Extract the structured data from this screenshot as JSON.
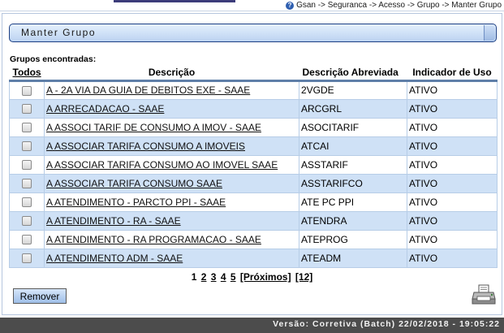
{
  "breadcrumb": "Gsan -> Seguranca -> Acesso -> Grupo -> Manter Grupo",
  "panel_title": "Manter Grupo",
  "list_label": "Grupos encontradas:",
  "columns": {
    "todos": "Todos",
    "descricao": "Descrição",
    "abreviada": "Descrição Abreviada",
    "uso": "Indicador de Uso"
  },
  "rows": [
    {
      "descricao": "A - 2A VIA DA GUIA DE DEBITOS EXE - SAAE",
      "abreviada": "2VGDE",
      "uso": "ATIVO"
    },
    {
      "descricao": "A ARRECADACAO - SAAE",
      "abreviada": "ARCGRL",
      "uso": "ATIVO"
    },
    {
      "descricao": "A ASSOCI TARIF DE CONSUMO A IMOV - SAAE",
      "abreviada": "ASOCITARIF",
      "uso": "ATIVO"
    },
    {
      "descricao": "A ASSOCIAR TARIFA CONSUMO A IMOVEIS",
      "abreviada": "ATCAI",
      "uso": "ATIVO"
    },
    {
      "descricao": "A ASSOCIAR TARIFA CONSUMO AO IMOVEL SAAE",
      "abreviada": "ASSTARIF",
      "uso": "ATIVO"
    },
    {
      "descricao": "A ASSOCIAR TARIFA CONSUMO SAAE",
      "abreviada": "ASSTARIFCO",
      "uso": "ATIVO"
    },
    {
      "descricao": "A ATENDIMENTO - PARCTO PPI - SAAE",
      "abreviada": "ATE PC PPI",
      "uso": "ATIVO"
    },
    {
      "descricao": "A ATENDIMENTO - RA - SAAE",
      "abreviada": "ATENDRA",
      "uso": "ATIVO"
    },
    {
      "descricao": "A ATENDIMENTO - RA PROGRAMACAO - SAAE",
      "abreviada": "ATEPROG",
      "uso": "ATIVO"
    },
    {
      "descricao": "A ATENDIMENTO ADM - SAAE",
      "abreviada": "ATEADM",
      "uso": "ATIVO"
    }
  ],
  "pager": {
    "current": "1",
    "pages": [
      "2",
      "3",
      "4",
      "5"
    ],
    "next_label": "[Próximos]",
    "last_label": "[12]"
  },
  "remove_label": "Remover",
  "version_text": "Versão: Corretiva (Batch) 22/02/2018 - 19:05:22",
  "colors": {
    "row_alt": "#cfe1f6",
    "header_rule": "#5f7fa8",
    "footer_bg": "#4c4c4c",
    "title_border": "#1c3f84"
  },
  "icons": {
    "help": "help-icon",
    "print": "printer-icon"
  }
}
